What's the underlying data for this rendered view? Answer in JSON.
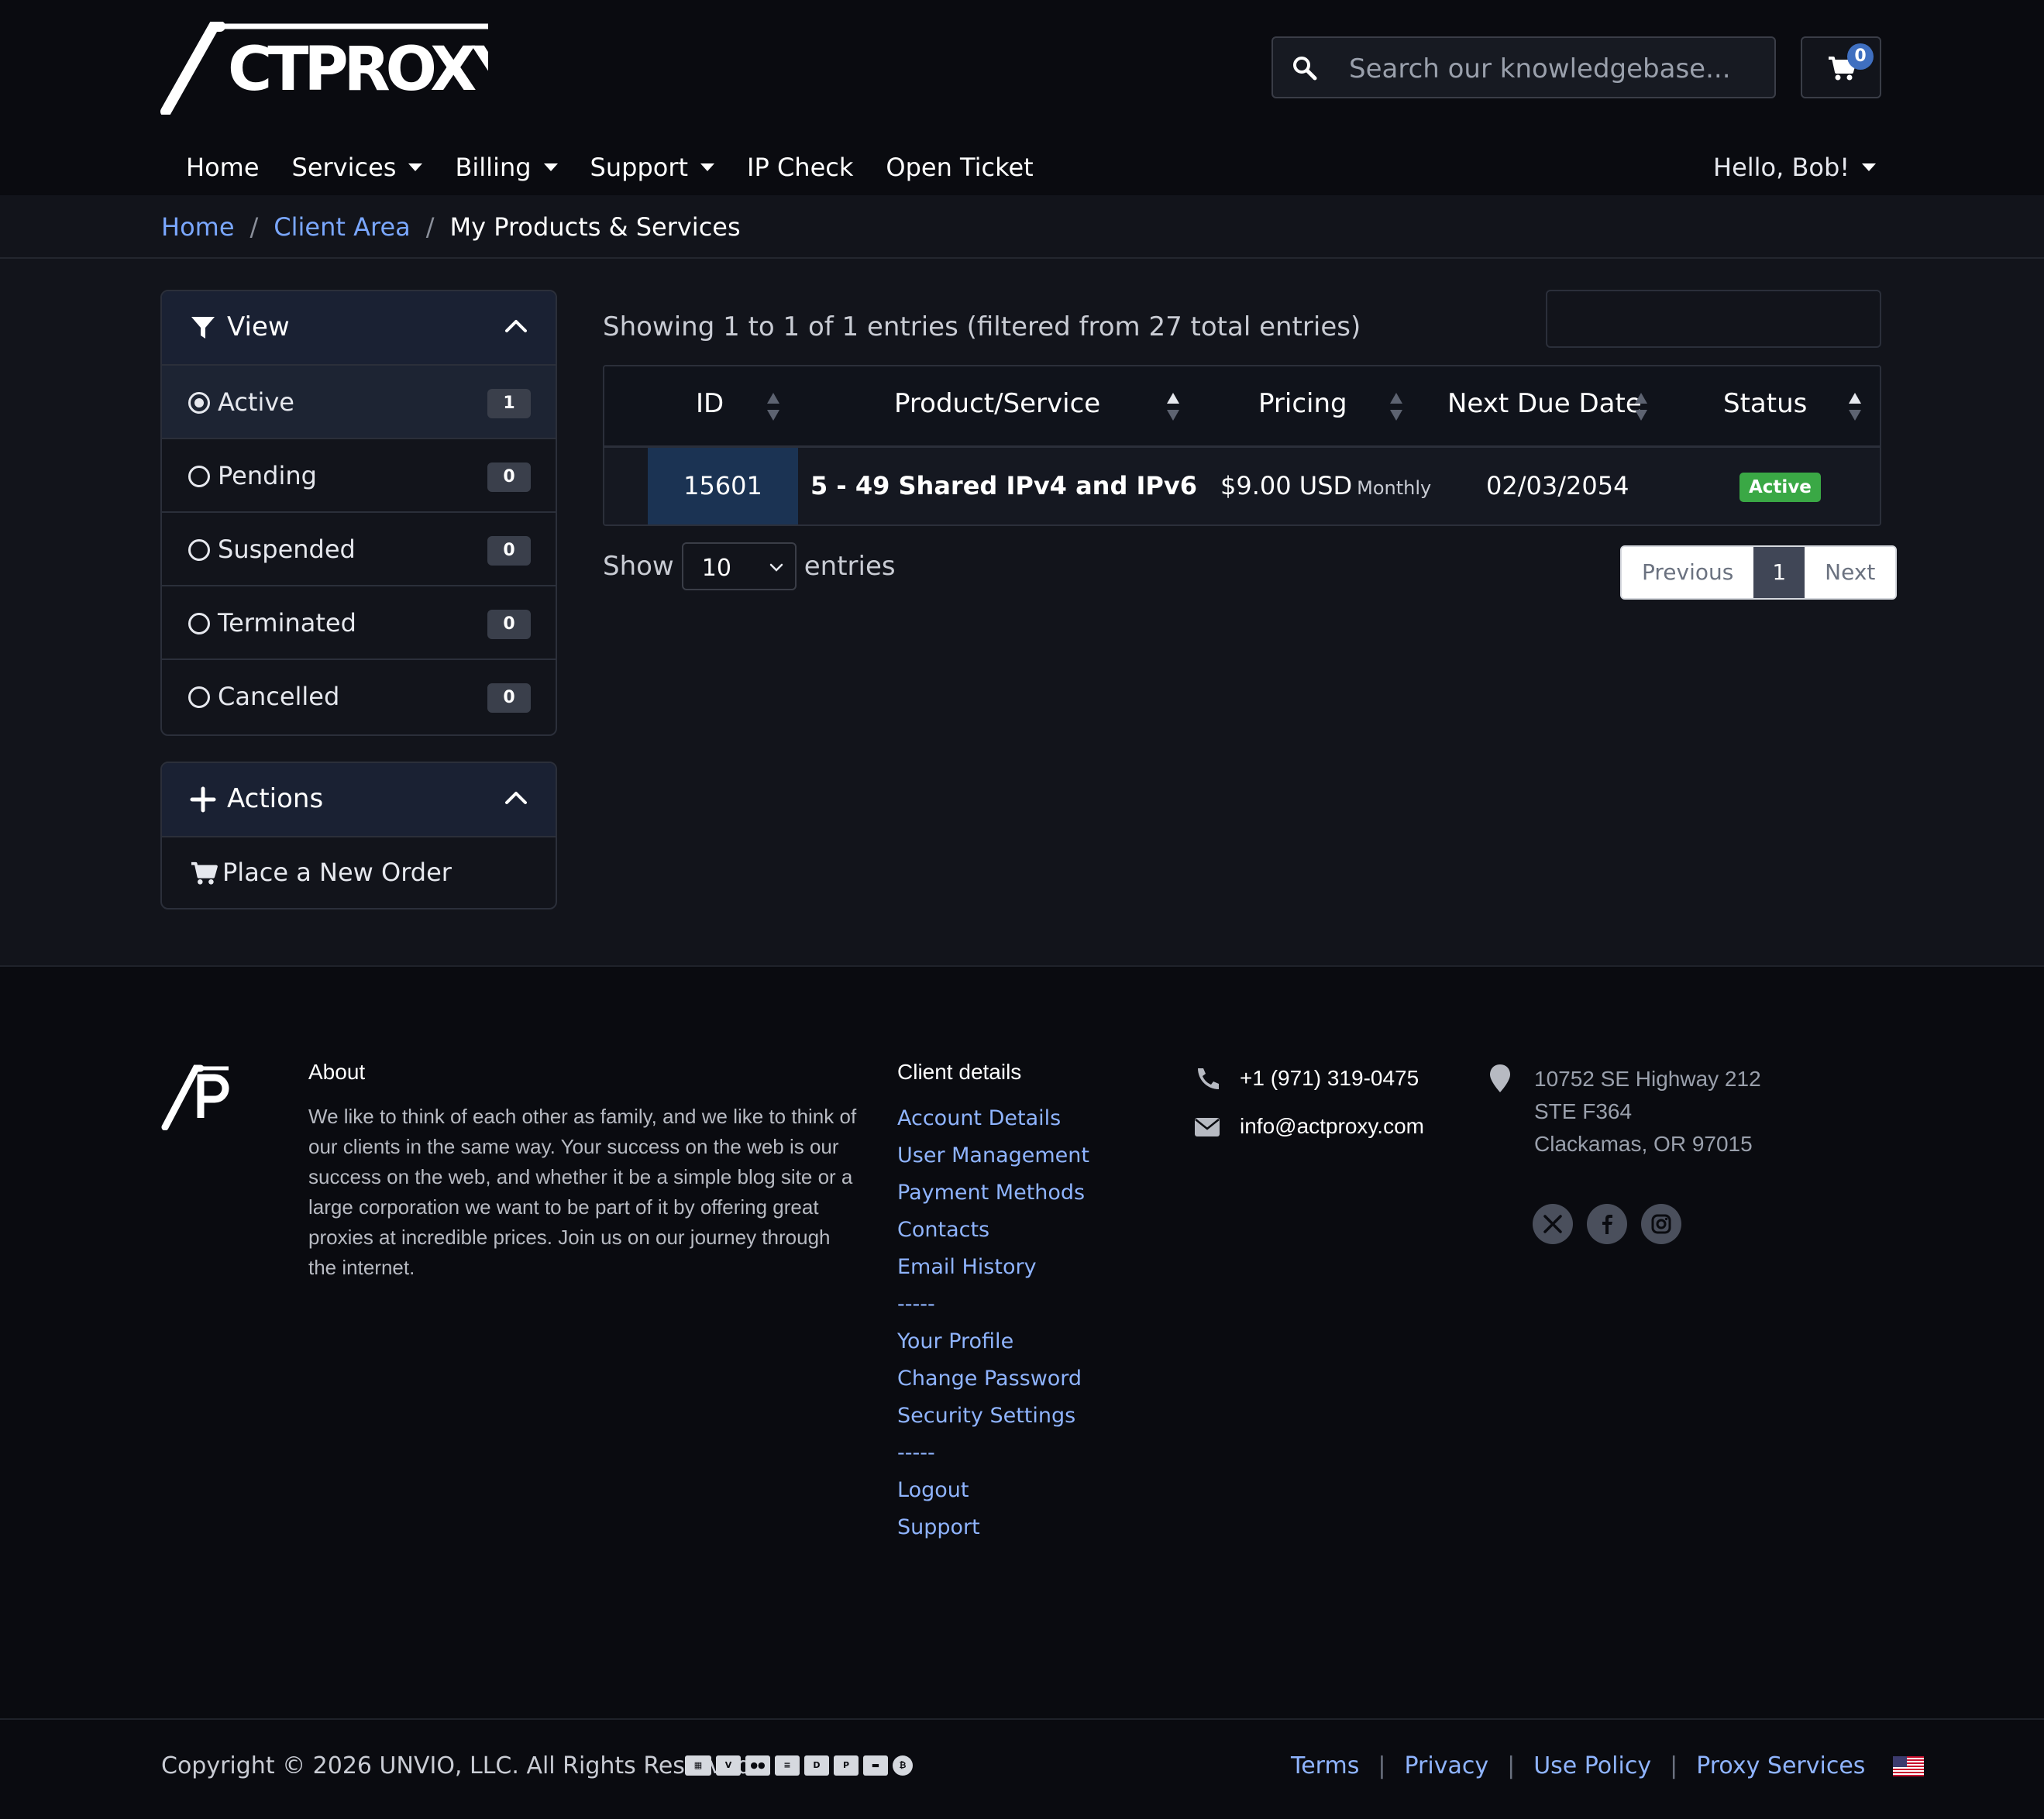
{
  "header": {
    "logo_text": "ACTPROXY",
    "search": {
      "placeholder": "Search our knowledgebase..."
    },
    "cart": {
      "count": "0"
    },
    "nav": [
      {
        "label": "Home",
        "has_dropdown": false
      },
      {
        "label": "Services",
        "has_dropdown": true
      },
      {
        "label": "Billing",
        "has_dropdown": true
      },
      {
        "label": "Support",
        "has_dropdown": true
      },
      {
        "label": "IP Check",
        "has_dropdown": false
      },
      {
        "label": "Open Ticket",
        "has_dropdown": false
      }
    ],
    "user_menu": "Hello, Bob!"
  },
  "breadcrumb": {
    "items": [
      "Home",
      "Client Area"
    ],
    "current": "My Products & Services"
  },
  "sidebar": {
    "view": {
      "title": "View",
      "items": [
        {
          "label": "Active",
          "count": "1",
          "selected": true
        },
        {
          "label": "Pending",
          "count": "0",
          "selected": false
        },
        {
          "label": "Suspended",
          "count": "0",
          "selected": false
        },
        {
          "label": "Terminated",
          "count": "0",
          "selected": false
        },
        {
          "label": "Cancelled",
          "count": "0",
          "selected": false
        }
      ]
    },
    "actions": {
      "title": "Actions",
      "items": [
        {
          "label": "Place a New Order",
          "icon": "cart-icon"
        }
      ]
    }
  },
  "table": {
    "info": "Showing 1 to 1 of 1 entries (filtered from 27 total entries)",
    "columns": [
      "ID",
      "Product/Service",
      "Pricing",
      "Next Due Date",
      "Status"
    ],
    "rows": [
      {
        "id": "15601",
        "product": "5 - 49 Shared IPv4 and IPv6",
        "price": "$9.00 USD",
        "cycle": "Monthly",
        "next_due": "02/03/2054",
        "status": "Active"
      }
    ],
    "length": {
      "show": "Show",
      "value": "10",
      "entries": "entries"
    },
    "pagination": {
      "previous": "Previous",
      "page": "1",
      "next": "Next"
    }
  },
  "footer": {
    "about": {
      "title": "About",
      "text": "We like to think of each other as family, and we like to think of our clients in the same way. Your success on the web is our success on the web, and whether it be a simple blog site or a large corporation we want to be part of it by offering great proxies at incredible prices. Join us on our journey through the internet."
    },
    "client": {
      "title": "Client details",
      "links": [
        "Account Details",
        "User Management",
        "Payment Methods",
        "Contacts",
        "Email History",
        "-----",
        "Your Profile",
        "Change Password",
        "Security Settings",
        "-----",
        "Logout",
        "Support"
      ]
    },
    "contact": {
      "phone": "+1 (971) 319-0475",
      "email": "info@actproxy.com"
    },
    "address": {
      "line1": "10752 SE Highway 212",
      "line2": "STE F364",
      "line3": "Clackamas, OR 97015"
    },
    "social": [
      "x-icon",
      "facebook-icon",
      "instagram-icon"
    ],
    "copyright": "Copyright © 2026 UNVIO, LLC. All Rights Reserved.",
    "payment_icons": [
      "bank-transfer-icon",
      "visa-icon",
      "mastercard-icon",
      "amex-icon",
      "discover-icon",
      "paypal-icon",
      "credit-card-icon",
      "bitcoin-icon"
    ],
    "bottom_links": [
      "Terms",
      "Privacy",
      "Use Policy",
      "Proxy Services"
    ],
    "locale_flag": "us-flag-icon"
  },
  "colors": {
    "background": "#12141b",
    "header": "#0a0b10",
    "link": "#7aa7ff",
    "id_cell": "#1b3353",
    "status_active": "#3aa845",
    "cart_badge": "#3f6fc0"
  }
}
